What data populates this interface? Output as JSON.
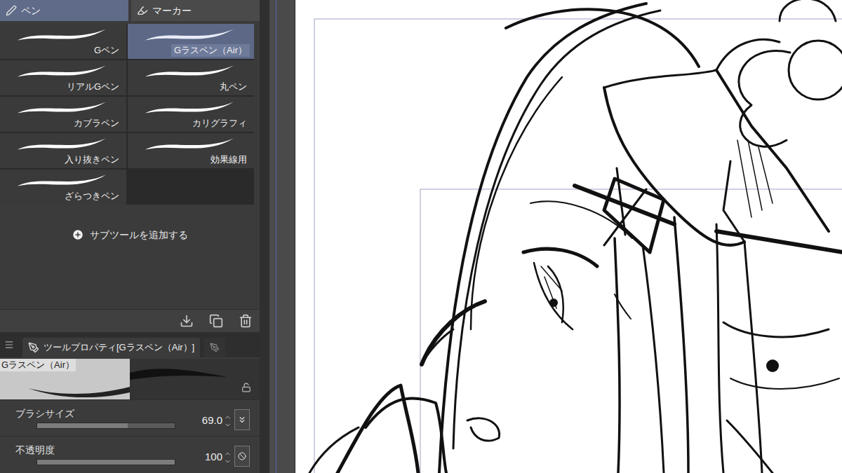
{
  "tool_tabs": [
    {
      "label": "ペン",
      "selected": true
    },
    {
      "label": "マーカー",
      "selected": false
    }
  ],
  "subtools": [
    {
      "label": "Gペン",
      "selected": false
    },
    {
      "label": "Gラスペン（Air）",
      "selected": true
    },
    {
      "label": "リアルGペン",
      "selected": false
    },
    {
      "label": "丸ペン",
      "selected": false
    },
    {
      "label": "カブラペン",
      "selected": false
    },
    {
      "label": "カリグラフィ",
      "selected": false
    },
    {
      "label": "入り抜きペン",
      "selected": false
    },
    {
      "label": "効果線用",
      "selected": false
    },
    {
      "label": "ざらつきペン",
      "selected": false
    }
  ],
  "add_subtool": {
    "label": "サブツールを追加する"
  },
  "property_panel": {
    "tab": "ツールプロパティ[Gラスペン（Air）]",
    "preview_label": "Gラスペン（Air）",
    "properties": [
      {
        "label": "ブラシサイズ",
        "value": "69.0",
        "level": 0.66
      },
      {
        "label": "不透明度",
        "value": "100",
        "level": 1
      }
    ]
  }
}
